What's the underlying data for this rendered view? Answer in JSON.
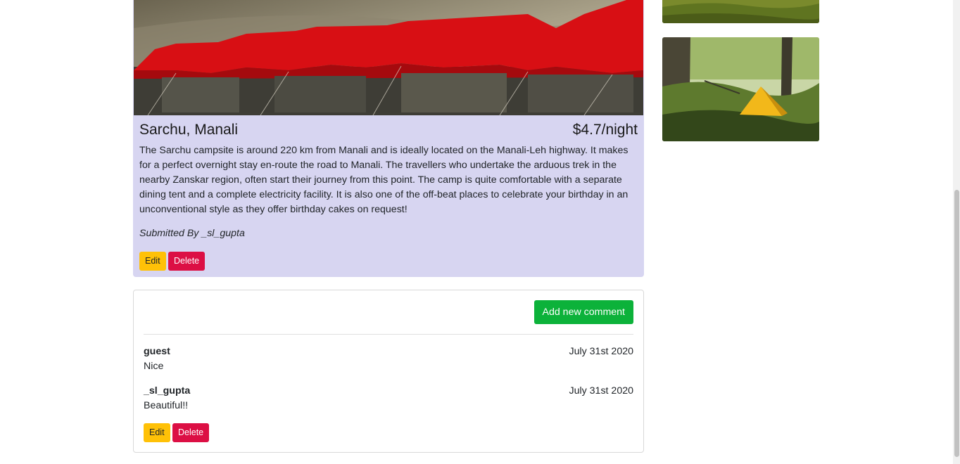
{
  "campground": {
    "name": "Sarchu, Manali",
    "price": "$4.7/night",
    "description": "The Sarchu campsite is around 220 km from Manali and is ideally located on the Manali-Leh highway. It makes for a perfect overnight stay en-route the road to Manali. The travellers who undertake the arduous trek in the nearby Zanskar region, often start their journey from this point. The camp is quite comfortable with a separate dining tent and a complete electricity facility. It is also one of the off-beat places to celebrate your birthday in an unconventional style as they offer birthday cakes on request!",
    "submitted_by": "Submitted By _sl_gupta",
    "edit_label": "Edit",
    "delete_label": "Delete"
  },
  "comments_section": {
    "add_label": "Add new comment",
    "comments": [
      {
        "author": "guest",
        "date": "July 31st 2020",
        "text": "Nice"
      },
      {
        "author": "_sl_gupta",
        "date": "July 31st 2020",
        "text": "Beautiful!!",
        "edit_label": "Edit",
        "delete_label": "Delete"
      }
    ]
  },
  "colors": {
    "card_bg": "#d7d5f1",
    "edit": "#ffc107",
    "delete": "#dc0f44",
    "add": "#0cb23a"
  }
}
